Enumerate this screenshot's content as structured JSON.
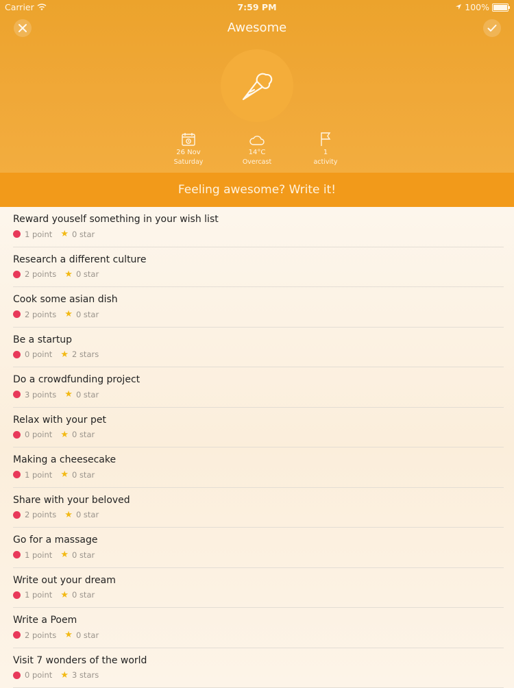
{
  "statusbar": {
    "carrier": "Carrier",
    "time": "7:59 PM",
    "battery": "100%"
  },
  "header": {
    "title": "Awesome",
    "mood_icon": "ice-cream-cone-icon"
  },
  "info": {
    "date": {
      "icon": "calendar-icon",
      "line1": "26 Nov",
      "line2": "Saturday"
    },
    "weather": {
      "icon": "cloud-icon",
      "line1": "14°C",
      "line2": "Overcast"
    },
    "activity": {
      "icon": "flag-icon",
      "line1": "1",
      "line2": "activity"
    }
  },
  "write_prompt": "Feeling awesome? Write it!",
  "colors": {
    "header": "#eca32c",
    "write_bar": "#f29a1a",
    "point_dot": "#e8395a",
    "star": "#f2b915"
  },
  "items": [
    {
      "title": "Reward youself something in your wish list",
      "points": "1 point",
      "stars": "0 star"
    },
    {
      "title": "Research a different culture",
      "points": "2 points",
      "stars": "0 star"
    },
    {
      "title": "Cook some asian dish",
      "points": "2 points",
      "stars": "0 star"
    },
    {
      "title": "Be a startup",
      "points": "0 point",
      "stars": "2 stars"
    },
    {
      "title": "Do a crowdfunding project",
      "points": "3 points",
      "stars": "0 star"
    },
    {
      "title": "Relax with your pet",
      "points": "0 point",
      "stars": "0 star"
    },
    {
      "title": "Making a cheesecake",
      "points": "1 point",
      "stars": "0 star"
    },
    {
      "title": "Share with your beloved",
      "points": "2 points",
      "stars": "0 star"
    },
    {
      "title": "Go for a massage",
      "points": "1 point",
      "stars": "0 star"
    },
    {
      "title": "Write out your dream",
      "points": "1 point",
      "stars": "0 star"
    },
    {
      "title": "Write a Poem",
      "points": "2 points",
      "stars": "0 star"
    },
    {
      "title": "Visit 7 wonders of the world",
      "points": "0 point",
      "stars": "3 stars"
    }
  ]
}
